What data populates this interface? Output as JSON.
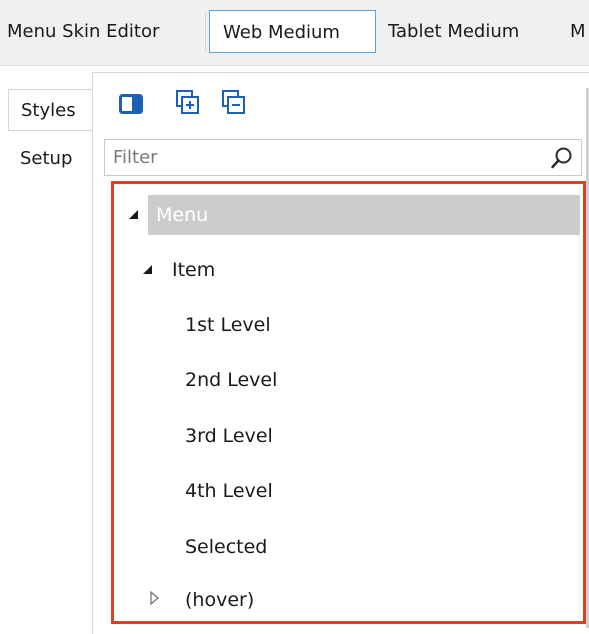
{
  "top_tabs": [
    "Menu Skin Editor",
    "Web Medium",
    "Tablet Medium",
    "M"
  ],
  "side_tabs": [
    "Styles",
    "Setup"
  ],
  "filter": {
    "placeholder": "Filter",
    "value": ""
  },
  "tree": {
    "root": "Menu",
    "item": "Item",
    "children": [
      "1st Level",
      "2nd Level",
      "3rd Level",
      "4th Level",
      "Selected"
    ],
    "hover": "(hover)"
  },
  "colors": {
    "highlight_border": "#d9411f",
    "selected_row": "#cccccc",
    "active_tab_border": "#5aa2d8",
    "toolbar_icon": "#1c5fb6"
  },
  "icons": {
    "toolbar": [
      "panel-toggle-icon",
      "expand-all-icon",
      "collapse-all-icon"
    ],
    "filter": "search-icon",
    "tree_expanded": "triangle-expanded-icon",
    "tree_collapsed": "triangle-collapsed-icon"
  }
}
